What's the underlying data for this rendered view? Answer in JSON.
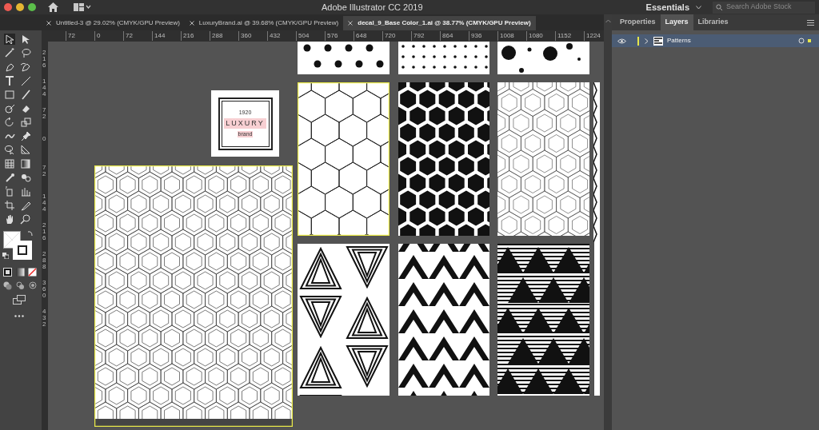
{
  "window": {
    "title": "Adobe Illustrator CC 2019"
  },
  "workspace": {
    "label": "Essentials"
  },
  "search": {
    "placeholder": "Search Adobe Stock"
  },
  "document_tabs": [
    {
      "label": "Untitled-3 @ 29.02% (CMYK/GPU Preview)",
      "selected": false
    },
    {
      "label": "LuxuryBrand.ai @ 39.68% (CMYK/GPU Preview)",
      "selected": false
    },
    {
      "label": "decal_9_Base Color_1.ai @ 38.77% (CMYK/GPU Preview)",
      "selected": true
    }
  ],
  "horizontal_ruler": [
    "72",
    "0",
    "72",
    "144",
    "216",
    "288",
    "360",
    "432",
    "504",
    "576",
    "648",
    "720",
    "792",
    "864",
    "936",
    "1008",
    "1080",
    "1152",
    "1224"
  ],
  "vertical_ruler": [
    "216",
    "144",
    "72",
    "0",
    "72",
    "144",
    "216",
    "288",
    "360",
    "432"
  ],
  "panel_tabs": [
    {
      "label": "Properties",
      "selected": false
    },
    {
      "label": "Layers",
      "selected": true
    },
    {
      "label": "Libraries",
      "selected": false
    }
  ],
  "layers": [
    {
      "name": "Patterns",
      "visible": true,
      "selected": true,
      "color": "#e6e64a"
    }
  ],
  "logo_card": {
    "year": "1920",
    "title": "LUXURY",
    "subtitle": "brand"
  },
  "artboards": [
    {
      "kind": "hexframe",
      "selected": true
    },
    {
      "kind": "dots",
      "selected": false
    },
    {
      "kind": "hexline",
      "selected": true
    },
    {
      "kind": "triline",
      "selected": false
    },
    {
      "kind": "smalldots",
      "selected": false
    },
    {
      "kind": "hexsolid",
      "selected": false
    },
    {
      "kind": "chevron",
      "selected": false
    },
    {
      "kind": "bigdots",
      "selected": false
    },
    {
      "kind": "hexfine",
      "selected": false
    },
    {
      "kind": "trisolid",
      "selected": false
    }
  ]
}
